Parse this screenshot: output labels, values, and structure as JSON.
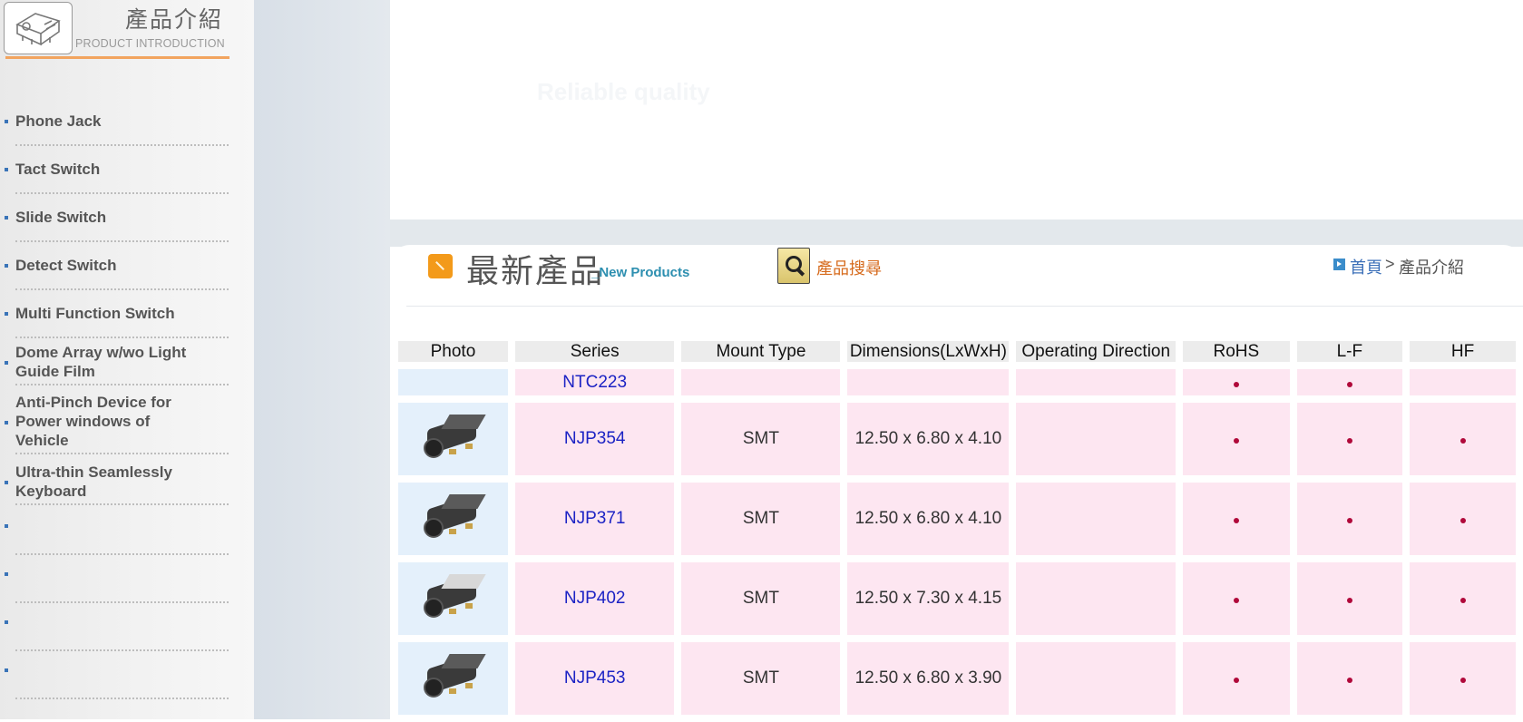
{
  "sidebar": {
    "title_zh": "產品介紹",
    "title_en": "PRODUCT INTRODUCTION",
    "items": [
      {
        "label": "Phone Jack"
      },
      {
        "label": "Tact Switch"
      },
      {
        "label": "Slide Switch"
      },
      {
        "label": "Detect Switch"
      },
      {
        "label": "Multi Function Switch"
      },
      {
        "label": "Dome Array w/wo Light Guide Film"
      },
      {
        "label": "Anti-Pinch Device for Power windows of Vehicle"
      },
      {
        "label": "Ultra-thin Seamlessly Keyboard"
      },
      {
        "label": ""
      },
      {
        "label": ""
      },
      {
        "label": ""
      },
      {
        "label": ""
      }
    ]
  },
  "banner": {
    "text": "Reliable quality"
  },
  "header": {
    "new_products_zh": "最新產品",
    "new_products_en": "_New Products",
    "search_label": "產品搜尋",
    "breadcrumb_home": "首頁",
    "breadcrumb_sep": ">",
    "breadcrumb_current": "產品介紹"
  },
  "table": {
    "columns": [
      "Photo",
      "Series",
      "Mount Type",
      "Dimensions(LxWxH)",
      "Operating Direction",
      "RoHS",
      "L-F",
      "HF"
    ],
    "dot_symbol": "",
    "rows": [
      {
        "series": "NTC223",
        "mount": "",
        "dims": "",
        "direction": "",
        "rohs": true,
        "lf": true,
        "hf": false
      },
      {
        "series": "NJP354",
        "mount": "SMT",
        "dims": "12.50 x 6.80 x 4.10",
        "direction": "",
        "rohs": true,
        "lf": true,
        "hf": true
      },
      {
        "series": "NJP371",
        "mount": "SMT",
        "dims": "12.50 x 6.80 x 4.10",
        "direction": "",
        "rohs": true,
        "lf": true,
        "hf": true
      },
      {
        "series": "NJP402",
        "mount": "SMT",
        "dims": "12.50 x 7.30 x 4.15",
        "direction": "",
        "rohs": true,
        "lf": true,
        "hf": true
      },
      {
        "series": "NJP453",
        "mount": "SMT",
        "dims": "12.50 x 6.80 x 3.90",
        "direction": "",
        "rohs": true,
        "lf": true,
        "hf": true
      }
    ]
  }
}
